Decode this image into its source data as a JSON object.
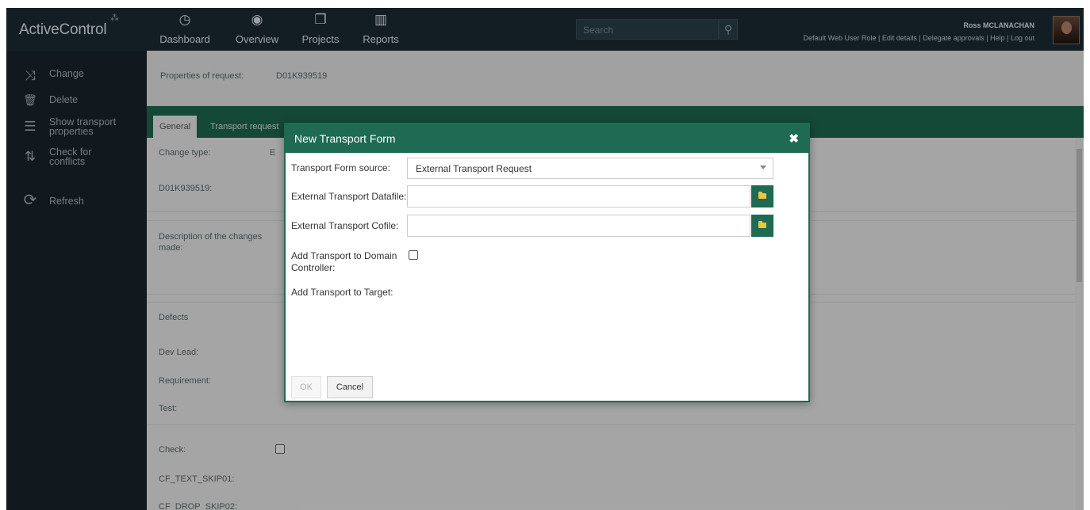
{
  "app": {
    "logo": "ActiveControl",
    "nav": [
      {
        "icon": "dashboard-gauge-icon",
        "glyph": "◷",
        "label": "Dashboard"
      },
      {
        "icon": "overview-eye-icon",
        "glyph": "◉",
        "label": "Overview"
      },
      {
        "icon": "projects-icon",
        "glyph": "❐",
        "label": "Projects"
      },
      {
        "icon": "reports-chart-icon",
        "glyph": "▥",
        "label": "Reports"
      }
    ],
    "search_placeholder": "Search",
    "user": {
      "name": "Ross MCLANACHAN",
      "links": "Default Web User Role | Edit details | Delegate approvals | Help | Log out"
    }
  },
  "sidebar": {
    "items": [
      {
        "icon": "change-shuffle-icon",
        "glyph": "⤨",
        "label": "Change"
      },
      {
        "icon": "delete-trash-icon",
        "glyph": "🗑",
        "label": "Delete"
      },
      {
        "icon": "transport-list-icon",
        "glyph": "☰",
        "label": "Show transport properties"
      },
      {
        "icon": "conflicts-icon",
        "glyph": "⇅",
        "label": "Check for conflicts"
      },
      {
        "icon": "refresh-icon",
        "glyph": "⟳",
        "label": "Refresh"
      }
    ]
  },
  "main": {
    "properties_label": "Properties of request:",
    "properties_value": "D01K939519",
    "tabs": [
      "General",
      "Transport request"
    ],
    "fields": {
      "change_type_label": "Change type:",
      "change_type_value": "E",
      "request_id_label": "D01K939519:",
      "description_label": "Description of the changes made:",
      "defects_label": "Defects",
      "dev_lead_label": "Dev Lead:",
      "requirement_label": "Requirement:",
      "test_label": "Test:",
      "check_label": "Check:",
      "cf_text_label": "CF_TEXT_SKIP01:",
      "cf_drop_label": "CF_DROP_SKIP02:"
    }
  },
  "modal": {
    "title": "New Transport Form",
    "close_glyph": "✖",
    "source_label": "Transport Form source:",
    "source_value": "External Transport Request",
    "datafile_label": "External Transport Datafile:",
    "datafile_value": "",
    "cofile_label": "External Transport Cofile:",
    "cofile_value": "",
    "domain_controller_label": "Add Transport to Domain Controller:",
    "domain_controller_checked": false,
    "target_label": "Add Transport to Target:",
    "ok_label": "OK",
    "cancel_label": "Cancel"
  },
  "colors": {
    "topbar": "#1c2d36",
    "sidebar": "#1a262d",
    "accent_green": "#1e6a52"
  }
}
